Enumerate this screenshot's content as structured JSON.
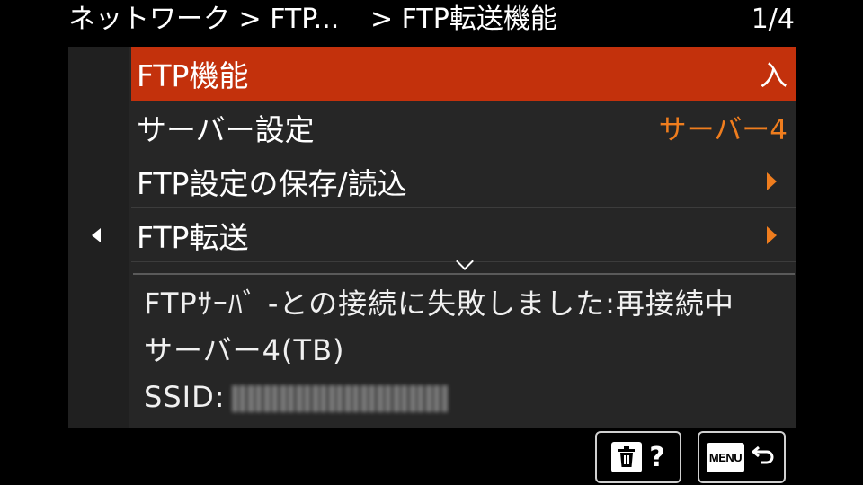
{
  "header": {
    "breadcrumb_1": "ネットワーク > FTP...",
    "breadcrumb_2": "> FTP転送機能",
    "page_indicator": "1/4"
  },
  "menu": {
    "items": [
      {
        "label": "FTP機能",
        "value": "入",
        "selected": true
      },
      {
        "label": "サーバー設定",
        "value": "サーバー4",
        "selected": false
      },
      {
        "label": "FTP設定の保存/読込",
        "value": "",
        "selected": false
      },
      {
        "label": "FTP転送",
        "value": "",
        "selected": false
      }
    ]
  },
  "status": {
    "line1": "FTPｻｰﾊﾞ -との接続に失敗しました:再接続中",
    "line2": "サーバー4(TB)",
    "ssid_label": "SSID:"
  },
  "footer": {
    "help_symbol": "?",
    "menu_label": "MENU"
  },
  "colors": {
    "selected_bg": "#c3310c",
    "accent_orange": "#ef7d1e",
    "panel_bg": "#262626"
  },
  "icons": [
    "left-arrow-icon",
    "chevron-right-icon",
    "chevron-down-icon",
    "trash-icon",
    "return-arrow-icon"
  ]
}
